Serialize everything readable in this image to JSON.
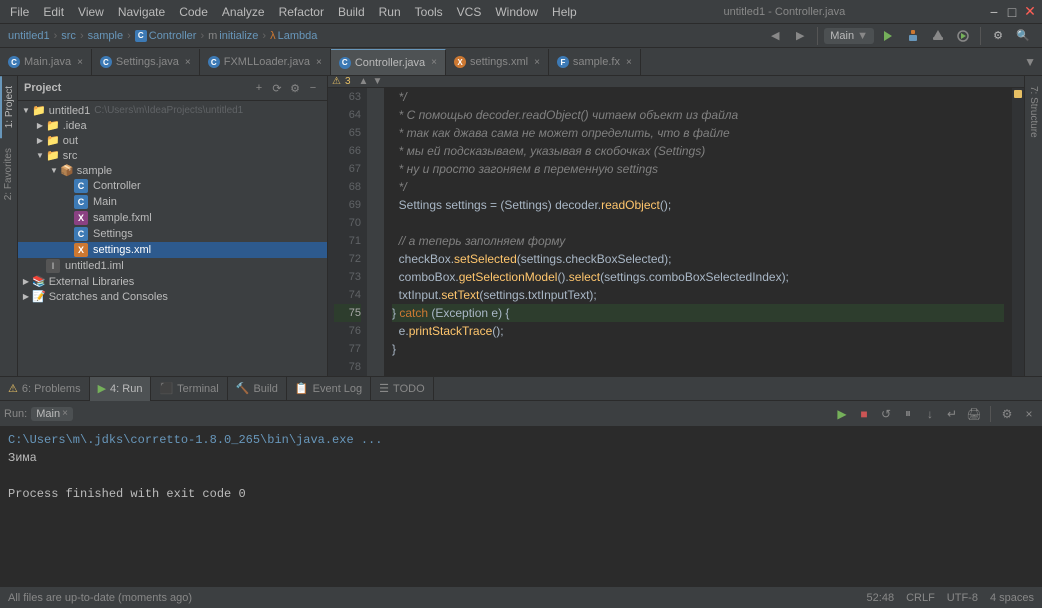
{
  "window": {
    "title": "untitled1 - Controller.java"
  },
  "menubar": {
    "items": [
      "File",
      "Edit",
      "View",
      "Navigate",
      "Code",
      "Analyze",
      "Refactor",
      "Build",
      "Run",
      "Tools",
      "VCS",
      "Window",
      "Help"
    ]
  },
  "breadcrumb": {
    "parts": [
      "untitled1",
      "src",
      "sample",
      "Controller",
      "initialize",
      "Lambda"
    ]
  },
  "toolbar": {
    "run_config": "Main",
    "icons": [
      "back",
      "forward",
      "undo",
      "redo"
    ]
  },
  "tabs": [
    {
      "label": "Main.java",
      "type": "java",
      "active": false
    },
    {
      "label": "Settings.java",
      "type": "java",
      "active": false
    },
    {
      "label": "FXMLLoader.java",
      "type": "java",
      "active": false
    },
    {
      "label": "Controller.java",
      "type": "java",
      "active": true
    },
    {
      "label": "settings.xml",
      "type": "xml",
      "active": false
    },
    {
      "label": "sample.fx",
      "type": "fx",
      "active": false
    }
  ],
  "project_panel": {
    "title": "Project",
    "tree": [
      {
        "id": "untitled1",
        "label": "untitled1",
        "path": "C:\\Users\\m\\IdeaProjects\\untitled1",
        "level": 0,
        "type": "project",
        "expanded": true
      },
      {
        "id": "idea",
        "label": ".idea",
        "level": 1,
        "type": "folder",
        "expanded": false
      },
      {
        "id": "out",
        "label": "out",
        "level": 1,
        "type": "folder-yellow",
        "expanded": false
      },
      {
        "id": "src",
        "label": "src",
        "level": 1,
        "type": "folder-blue",
        "expanded": true
      },
      {
        "id": "sample",
        "label": "sample",
        "level": 2,
        "type": "folder-blue",
        "expanded": true
      },
      {
        "id": "controller",
        "label": "Controller",
        "level": 3,
        "type": "java",
        "expanded": false
      },
      {
        "id": "main",
        "label": "Main",
        "level": 3,
        "type": "java",
        "expanded": false
      },
      {
        "id": "samplefxml",
        "label": "sample.fxml",
        "level": 3,
        "type": "xml",
        "expanded": false
      },
      {
        "id": "settings",
        "label": "Settings",
        "level": 3,
        "type": "java",
        "expanded": false
      },
      {
        "id": "settingsxml",
        "label": "settings.xml",
        "level": 3,
        "type": "xml-orange",
        "expanded": false,
        "selected": true
      },
      {
        "id": "untitled1iml",
        "label": "untitled1.iml",
        "level": 1,
        "type": "iml",
        "expanded": false
      },
      {
        "id": "extlibs",
        "label": "External Libraries",
        "level": 0,
        "type": "folder",
        "expanded": false
      },
      {
        "id": "scratches",
        "label": "Scratches and Consoles",
        "level": 0,
        "type": "folder",
        "expanded": false
      }
    ]
  },
  "vertical_tabs_left": [
    {
      "label": "1: Project",
      "active": true
    },
    {
      "label": "2: Favorites",
      "active": false
    },
    {
      "label": "1: Project",
      "active": false
    }
  ],
  "vertical_tabs_right": [
    {
      "label": "7: Structure",
      "active": false
    }
  ],
  "code": {
    "lines": [
      {
        "num": 63,
        "text": "  */",
        "type": "comment"
      },
      {
        "num": 64,
        "text": "  * С помощью decoder.readObject() читаем объект из файла",
        "type": "comment"
      },
      {
        "num": 65,
        "text": "  * так как джава сама не может определить, что в файле",
        "type": "comment"
      },
      {
        "num": 66,
        "text": "  * мы ей подсказываем, указывая в скобочках (Settings)",
        "type": "comment"
      },
      {
        "num": 67,
        "text": "  * ну и просто загоняем в переменную settings",
        "type": "comment"
      },
      {
        "num": 68,
        "text": "  */",
        "type": "comment"
      },
      {
        "num": 69,
        "text": "  Settings settings = (Settings) decoder.readObject();",
        "type": "plain"
      },
      {
        "num": 70,
        "text": "",
        "type": "plain"
      },
      {
        "num": 71,
        "text": "  // а теперь заполняем форму",
        "type": "comment"
      },
      {
        "num": 72,
        "text": "  checkBox.setSelected(settings.checkBoxSelected);",
        "type": "plain"
      },
      {
        "num": 73,
        "text": "  comboBox.getSelectionModel().select(settings.comboBoxSelectedIndex);",
        "type": "plain"
      },
      {
        "num": 74,
        "text": "  txtInput.setText(settings.txtInputText);",
        "type": "plain"
      },
      {
        "num": 75,
        "text": "} catch (Exception e) {",
        "type": "plain"
      },
      {
        "num": 76,
        "text": "  e.printStackTrace();",
        "type": "plain"
      },
      {
        "num": 77,
        "text": "}",
        "type": "plain"
      },
      {
        "num": 78,
        "text": "",
        "type": "plain"
      }
    ]
  },
  "bottom_panel": {
    "run_tab_label": "Run:",
    "run_config": "Main",
    "tabs": [
      {
        "label": "6: Problems",
        "active": false
      },
      {
        "label": "4: Run",
        "active": true
      },
      {
        "label": "Terminal",
        "active": false
      },
      {
        "label": "Build",
        "active": false
      },
      {
        "label": "Event Log",
        "active": false
      },
      {
        "label": "TODO",
        "active": false
      }
    ],
    "output": [
      {
        "text": "C:\\Users\\m\\.jdks\\corretto-1.8.0_265\\bin\\java.exe ...",
        "type": "path"
      },
      {
        "text": "Зима",
        "type": "normal"
      },
      {
        "text": "",
        "type": "normal"
      },
      {
        "text": "Process finished with exit code 0",
        "type": "normal"
      }
    ]
  },
  "status_bar": {
    "message": "All files are up-to-date (moments ago)",
    "position": "52:48",
    "line_separator": "CRLF",
    "encoding": "UTF-8",
    "indent": "4 spaces"
  },
  "warnings": {
    "count": 3
  }
}
